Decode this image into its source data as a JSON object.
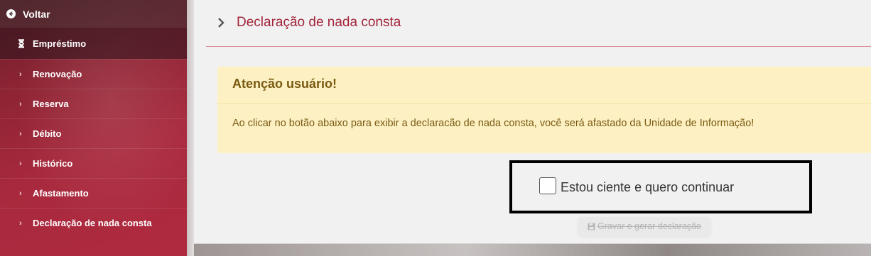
{
  "sidebar": {
    "back_label": "Voltar",
    "section_label": "Empréstimo",
    "items": [
      {
        "label": "Renovação"
      },
      {
        "label": "Reserva"
      },
      {
        "label": "Débito"
      },
      {
        "label": "Histórico"
      },
      {
        "label": "Afastamento"
      },
      {
        "label": "Declaração de nada consta"
      }
    ]
  },
  "main": {
    "title": "Declaração de nada consta",
    "alert": {
      "title": "Atenção usuário!",
      "text": "Ao clicar no botão abaixo para exibir a declaracão de nada consta, você será afastado da Unidade de Informação!"
    },
    "confirm": {
      "label": "Estou ciente e quero continuar",
      "checked": false
    },
    "generate_button": "Gravar e gerar declaração"
  },
  "colors": {
    "accent": "#a3243a",
    "alert_bg": "#fdf1c4",
    "alert_text": "#7a5a11",
    "sidebar": "#a8293d"
  }
}
